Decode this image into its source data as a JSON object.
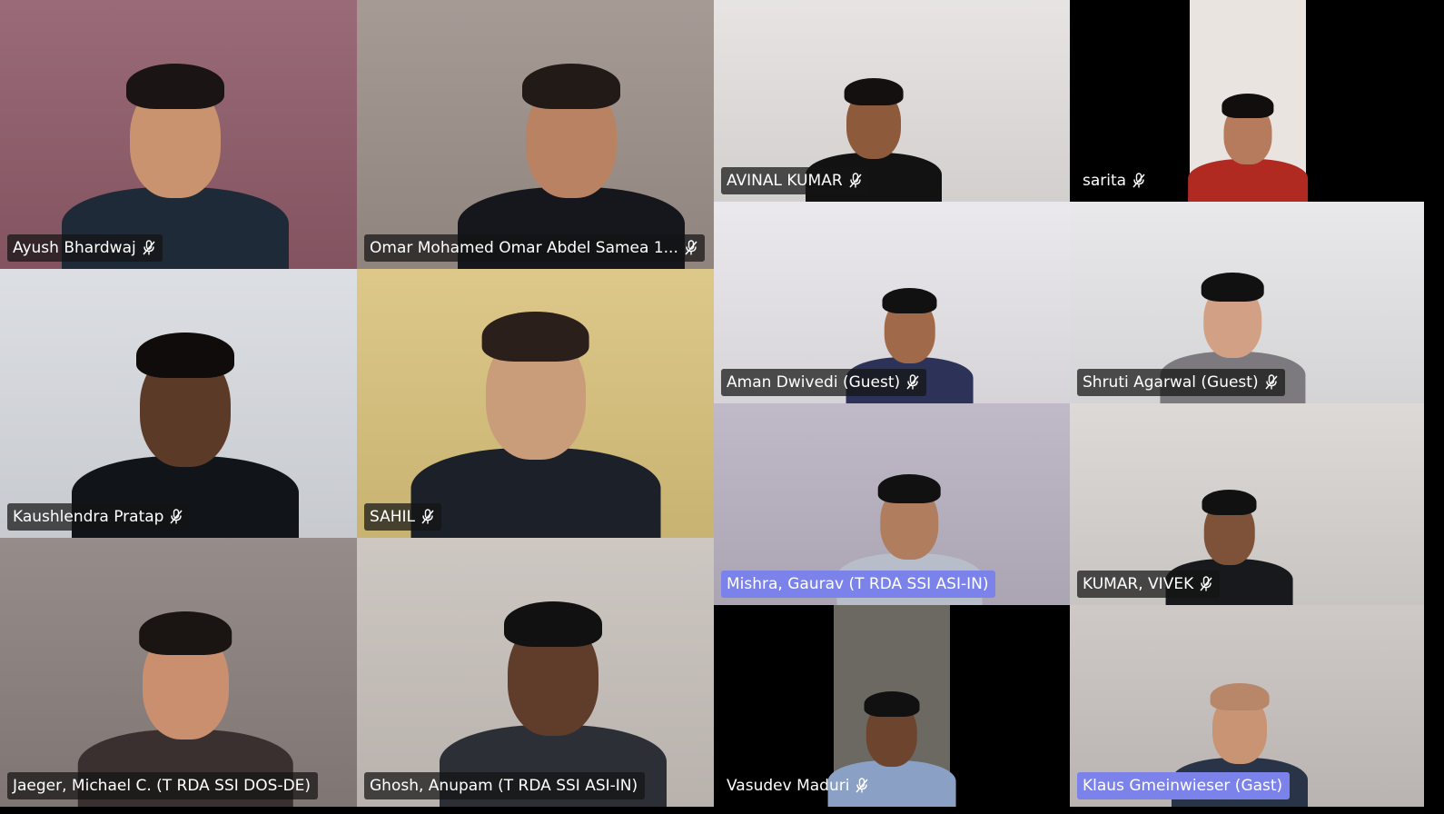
{
  "meeting": {
    "participants": [
      {
        "name": "Ayush Bhardwaj",
        "muted": true,
        "bg": "#8e5a68",
        "shirt": "#1f2a38",
        "skin": "#c8936e",
        "hair": "#1b1414"
      },
      {
        "name": "Omar Mohamed Omar Abdel Samea 1...",
        "muted": true,
        "bg": "#9c8f89",
        "shirt": "#15171c",
        "skin": "#b98263",
        "hair": "#221a16"
      },
      {
        "name": "AVINAL KUMAR",
        "muted": true,
        "bg": "#e4e1df",
        "shirt": "#121212",
        "skin": "#8d5a3c",
        "hair": "#141010"
      },
      {
        "name": "sarita",
        "muted": true,
        "bg": "#000000",
        "inset_bg": "#e9e4e0",
        "shirt": "#b02a22",
        "skin": "#b67a5c",
        "hair": "#120e0e"
      },
      {
        "name": "Kaushlendra Pratap",
        "muted": true,
        "bg": "#d8dbe0",
        "shirt": "#111418",
        "skin": "#5b3a28",
        "hair": "#0f0c0b"
      },
      {
        "name": "SAHIL",
        "muted": true,
        "bg": "#d9c27c",
        "shirt": "#1c2129",
        "skin": "#c99c7a",
        "hair": "#2a1f1a"
      },
      {
        "name": "Aman Dwivedi (Guest)",
        "muted": true,
        "bg": "#e8e6ea",
        "shirt": "#2d3358",
        "skin": "#a06a4a",
        "hair": "#111"
      },
      {
        "name": "Shruti Agarwal (Guest)",
        "muted": true,
        "bg": "#e6e6e8",
        "shirt": "#7c7a7e",
        "skin": "#d2a085",
        "hair": "#111"
      },
      {
        "name": "Mishra, Gaurav (T RDA SSI ASI-IN)",
        "muted": false,
        "speaking": true,
        "bg": "#b9b2c2",
        "shirt": "#b8bec9",
        "skin": "#b07e5e",
        "hair": "#111"
      },
      {
        "name": "KUMAR, VIVEK",
        "muted": true,
        "bg": "#d9d5d2",
        "shirt": "#17191c",
        "skin": "#7d5238",
        "hair": "#111"
      },
      {
        "name": "Jaeger, Michael C. (T RDA SSI DOS-DE)",
        "muted": false,
        "bg": "#8a7f7c",
        "shirt": "#3a3030",
        "skin": "#c98f6e",
        "hair": "#1a1412"
      },
      {
        "name": "Ghosh, Anupam (T RDA SSI ASI-IN)",
        "muted": false,
        "bg": "#c8c1bc",
        "shirt": "#2c2f35",
        "skin": "#5f3d2a",
        "hair": "#111"
      },
      {
        "name": "Vasudev Maduri",
        "muted": true,
        "bg": "#000000",
        "inset_bg": "#6c6862",
        "shirt": "#8aa0c4",
        "skin": "#6d452f",
        "hair": "#111"
      },
      {
        "name": "Klaus Gmeinwieser (Gast)",
        "muted": false,
        "speaking": true,
        "bg": "#c9c3c0",
        "shirt": "#2a3448",
        "skin": "#c99474",
        "hair": "#b8876a"
      }
    ]
  },
  "colors": {
    "speaking_label": "#7b83eb",
    "label_bg": "rgba(20,20,20,0.72)",
    "stage_bg": "#000000"
  },
  "icons": {
    "mic": "mic-off-icon"
  }
}
